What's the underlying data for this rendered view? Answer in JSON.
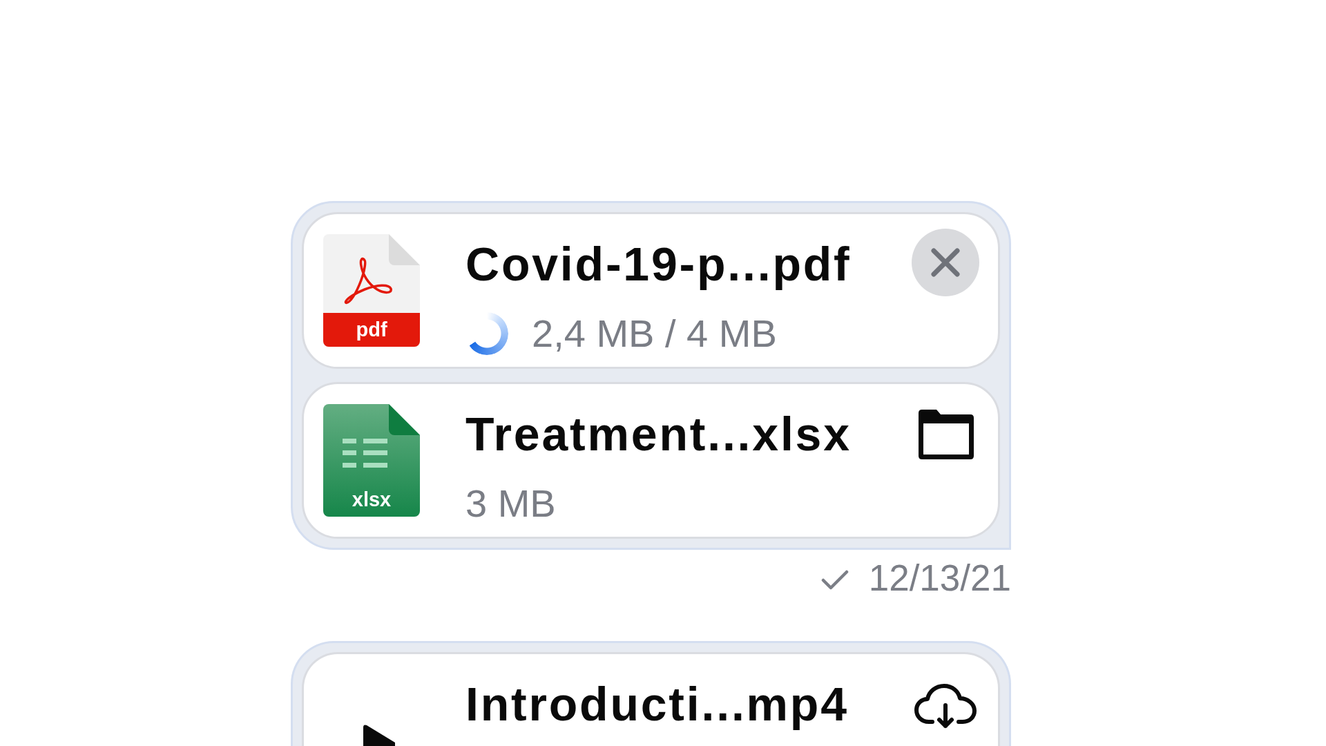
{
  "messages": [
    {
      "files": [
        {
          "kind": "pdf",
          "type_label": "pdf",
          "name": "Covid-19-p...pdf",
          "size": "2,4 MB / 4 MB",
          "in_progress": true
        },
        {
          "kind": "xlsx",
          "type_label": "xlsx",
          "name": "Treatment...xlsx",
          "size": "3 MB",
          "in_progress": false,
          "saved": true
        }
      ],
      "delivered": true,
      "time": "12/13/21"
    },
    {
      "files": [
        {
          "kind": "video",
          "name": "Introducti...mp4",
          "in_progress": false,
          "saved": false
        }
      ]
    }
  ]
}
